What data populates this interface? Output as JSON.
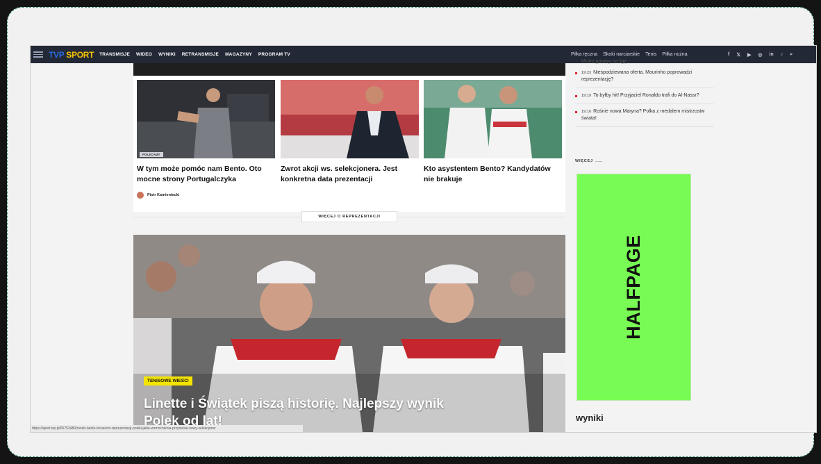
{
  "nav": {
    "logo_tvp": "TVP",
    "logo_sport": "SPORT",
    "main_items": [
      "TRANSMISJE",
      "WIDEO",
      "WYNIKI",
      "RETRANSMISJE",
      "MAGAZYNY",
      "PROGRAM TV"
    ],
    "right_items": [
      "Piłka ręczna",
      "Skoki narciarskie",
      "Tenis",
      "Piłka nożna"
    ],
    "social": [
      "f",
      "𝕏",
      "▶",
      "◎",
      "in",
      "♪",
      "⌕"
    ]
  },
  "cards": [
    {
      "title": "W tym może pomóc nam Bento. Oto mocne strony Portugalczyka",
      "badge": "POLECAMY",
      "author": "Piotr Kamieniecki"
    },
    {
      "title": "Zwrot akcji ws. selekcjonera. Jest konkretna data prezentacji"
    },
    {
      "title": "Kto asystentem Bento? Kandydatów nie brakuje"
    }
  ],
  "more_button": "WIĘCEJ O REPREZENTACJI",
  "featured": {
    "tag": "TENISOWE WIEŚCI",
    "title": "Linette i Świątek piszą historię. Najlepszy wynik Polek od lat!"
  },
  "statusbar": "https://sport.tvp.pl/65753480/rondo-bento-trenerem-reprezentacji-polski-jakie-wzmocnienia-przyniesie-nowy-selekcjoner",
  "sidebar": {
    "top_fragment": "Mistrz gotowy na ligę",
    "news": [
      {
        "time": "19:23",
        "text": "Niespodziewana oferta. Mourinho poprowadzi reprezentację?"
      },
      {
        "time": "19:19",
        "text": "To byłby hit! Przyjaciel Ronaldo trafi do Al-Nassr?"
      },
      {
        "time": "19:16",
        "text": "Rośnie nowa Maryna? Polka z medalem mistrzostw świata!"
      }
    ],
    "more_label": "WIĘCEJ",
    "ad_label": "HALFPAGE",
    "results_heading": "wyniki"
  }
}
